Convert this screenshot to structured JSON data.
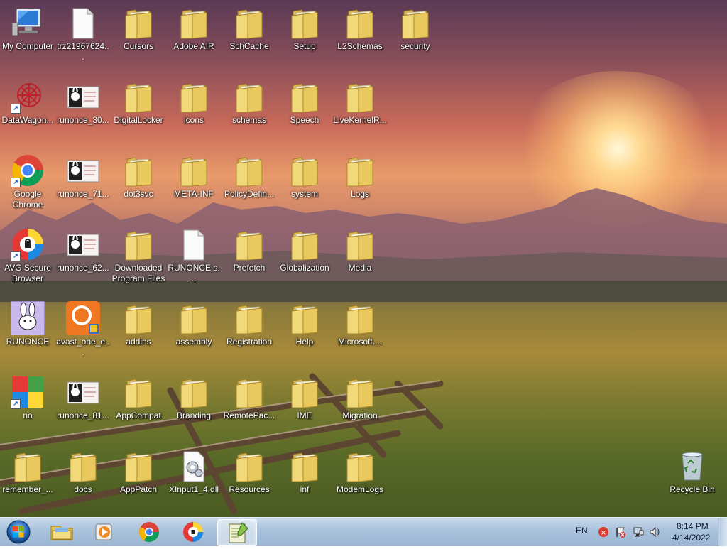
{
  "desktop": {
    "icons": [
      {
        "label": "My Computer",
        "type": "computer-icon"
      },
      {
        "label": "trz21967624...",
        "type": "file-icon"
      },
      {
        "label": "Cursors",
        "type": "folder-icon"
      },
      {
        "label": "Adobe AIR",
        "type": "folder-icon"
      },
      {
        "label": "SchCache",
        "type": "folder-icon"
      },
      {
        "label": "Setup",
        "type": "folder-icon"
      },
      {
        "label": "L2Schemas",
        "type": "folder-icon"
      },
      {
        "label": "security",
        "type": "folder-icon"
      },
      {
        "label": "DataWagon...",
        "type": "shortcut-icon"
      },
      {
        "label": "runonce_30...",
        "type": "image-file-icon"
      },
      {
        "label": "DigitalLocker",
        "type": "folder-icon"
      },
      {
        "label": "icons",
        "type": "folder-icon"
      },
      {
        "label": "schemas",
        "type": "folder-icon"
      },
      {
        "label": "Speech",
        "type": "folder-icon"
      },
      {
        "label": "LiveKernelR...",
        "type": "folder-icon"
      },
      {
        "label": "Google Chrome",
        "type": "chrome-icon"
      },
      {
        "label": "runonce_71...",
        "type": "image-file-icon"
      },
      {
        "label": "dot3svc",
        "type": "folder-icon"
      },
      {
        "label": "META-INF",
        "type": "folder-icon"
      },
      {
        "label": "PolicyDefin...",
        "type": "folder-icon"
      },
      {
        "label": "system",
        "type": "folder-icon"
      },
      {
        "label": "Logs",
        "type": "folder-icon"
      },
      {
        "label": "AVG Secure Browser",
        "type": "avg-browser-icon"
      },
      {
        "label": "runonce_62...",
        "type": "image-file-icon"
      },
      {
        "label": "Downloaded Program Files",
        "type": "folder-icon"
      },
      {
        "label": "RUNONCE.s...",
        "type": "file-icon"
      },
      {
        "label": "Prefetch",
        "type": "folder-icon"
      },
      {
        "label": "Globalization",
        "type": "folder-icon"
      },
      {
        "label": "Media",
        "type": "folder-icon"
      },
      {
        "label": "RUNONCE",
        "type": "runonce-icon"
      },
      {
        "label": "avast_one_e...",
        "type": "avast-installer-icon"
      },
      {
        "label": "addins",
        "type": "folder-icon"
      },
      {
        "label": "assembly",
        "type": "folder-icon"
      },
      {
        "label": "Registration",
        "type": "folder-icon"
      },
      {
        "label": "Help",
        "type": "folder-icon"
      },
      {
        "label": "Microsoft....",
        "type": "folder-icon"
      },
      {
        "label": "no",
        "type": "avg-shortcut-icon"
      },
      {
        "label": "runonce_81...",
        "type": "image-file-icon"
      },
      {
        "label": "AppCompat",
        "type": "folder-icon"
      },
      {
        "label": "Branding",
        "type": "folder-icon"
      },
      {
        "label": "RemotePac...",
        "type": "folder-icon"
      },
      {
        "label": "IME",
        "type": "folder-icon"
      },
      {
        "label": "Migration",
        "type": "folder-icon"
      },
      {
        "label": "remember_...",
        "type": "folder-icon"
      },
      {
        "label": "docs",
        "type": "folder-icon"
      },
      {
        "label": "AppPatch",
        "type": "folder-icon"
      },
      {
        "label": "XInput1_4.dll",
        "type": "dll-file-icon"
      },
      {
        "label": "Resources",
        "type": "folder-icon"
      },
      {
        "label": "inf",
        "type": "folder-icon"
      },
      {
        "label": "ModemLogs",
        "type": "folder-icon"
      },
      {
        "label": "Recycle Bin",
        "type": "recycle-bin-icon"
      }
    ]
  },
  "taskbar": {
    "start": "start-orb-icon",
    "pinned": [
      {
        "name": "explorer",
        "icon": "file-explorer-icon"
      },
      {
        "name": "media-player",
        "icon": "media-player-icon"
      },
      {
        "name": "chrome",
        "icon": "chrome-icon"
      },
      {
        "name": "avg-browser",
        "icon": "avg-browser-icon"
      },
      {
        "name": "notepad-plus",
        "icon": "notepad-plus-icon"
      }
    ],
    "tray": {
      "language": "EN",
      "time": "8:14 PM",
      "date": "4/14/2022"
    }
  }
}
